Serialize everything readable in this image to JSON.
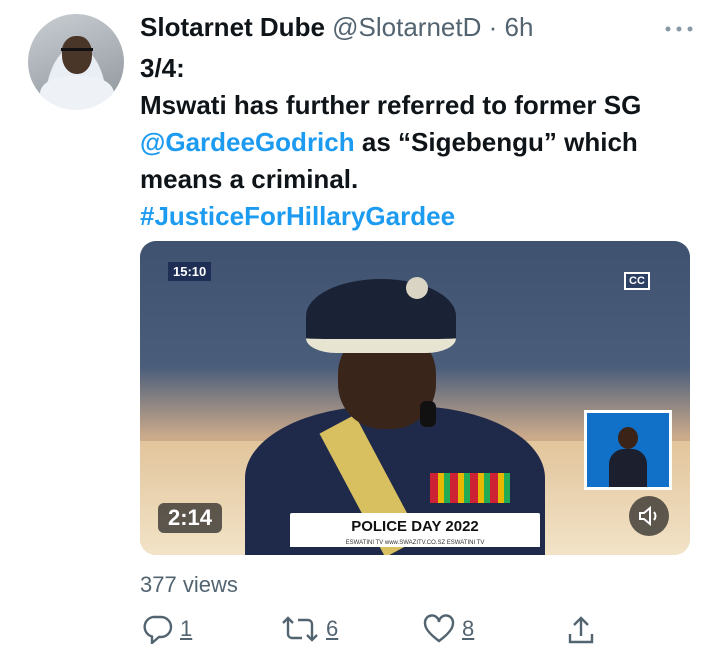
{
  "author": {
    "name": "Slotarnet Dube",
    "handle": "@SlotarnetD",
    "separator": "·",
    "time": "6h"
  },
  "more_icon": "ellipsis-icon",
  "tweet": {
    "line1": "3/4:",
    "text_before_mention": "Mswati has further referred to former SG ",
    "mention": "@GardeeGodrich",
    "text_after_mention": " as “Sigebengu” which means a criminal.",
    "hashtag": "#JusticeForHillaryGardee"
  },
  "video": {
    "timestamp": "15:10",
    "duration": "2:14",
    "banner": "POLICE DAY 2022",
    "banner_links": "ESWATINI TV   www.SWAZITV.CO.SZ   ESWATINI TV",
    "cc_label": "CC",
    "mute_icon": "speaker-mute-icon"
  },
  "stats": {
    "views": "377 views"
  },
  "actions": {
    "reply_count": "1",
    "retweet_count": "6",
    "like_count": "8"
  },
  "colors": {
    "link": "#1d9bf0",
    "text": "#0f1419",
    "muted": "#536471"
  }
}
